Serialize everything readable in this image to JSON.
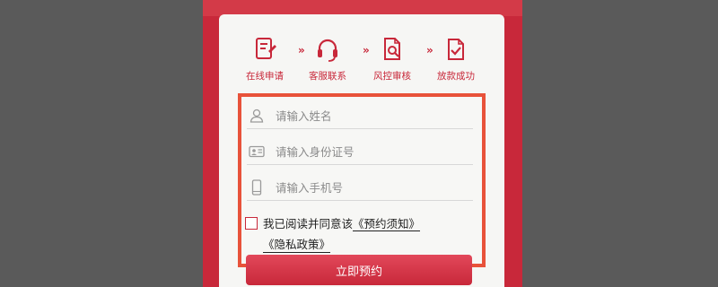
{
  "steps": [
    {
      "label": "在线申请",
      "icon": "online-application-icon"
    },
    {
      "label": "客服联系",
      "icon": "headset-icon"
    },
    {
      "label": "风控审核",
      "icon": "document-search-icon"
    },
    {
      "label": "放款成功",
      "icon": "document-check-icon"
    }
  ],
  "step_separator": "»",
  "form": {
    "name_placeholder": "请输入姓名",
    "id_placeholder": "请输入身份证号",
    "phone_placeholder": "请输入手机号",
    "agree_prefix": "我已阅读并同意该",
    "agree_link_1": "《预约须知》",
    "agree_link_2": "《隐私政策》",
    "submit_label": "立即预约"
  },
  "colors": {
    "brand_red": "#c8283a",
    "highlight_border": "#e8523a",
    "background": "#5a5a5a"
  }
}
